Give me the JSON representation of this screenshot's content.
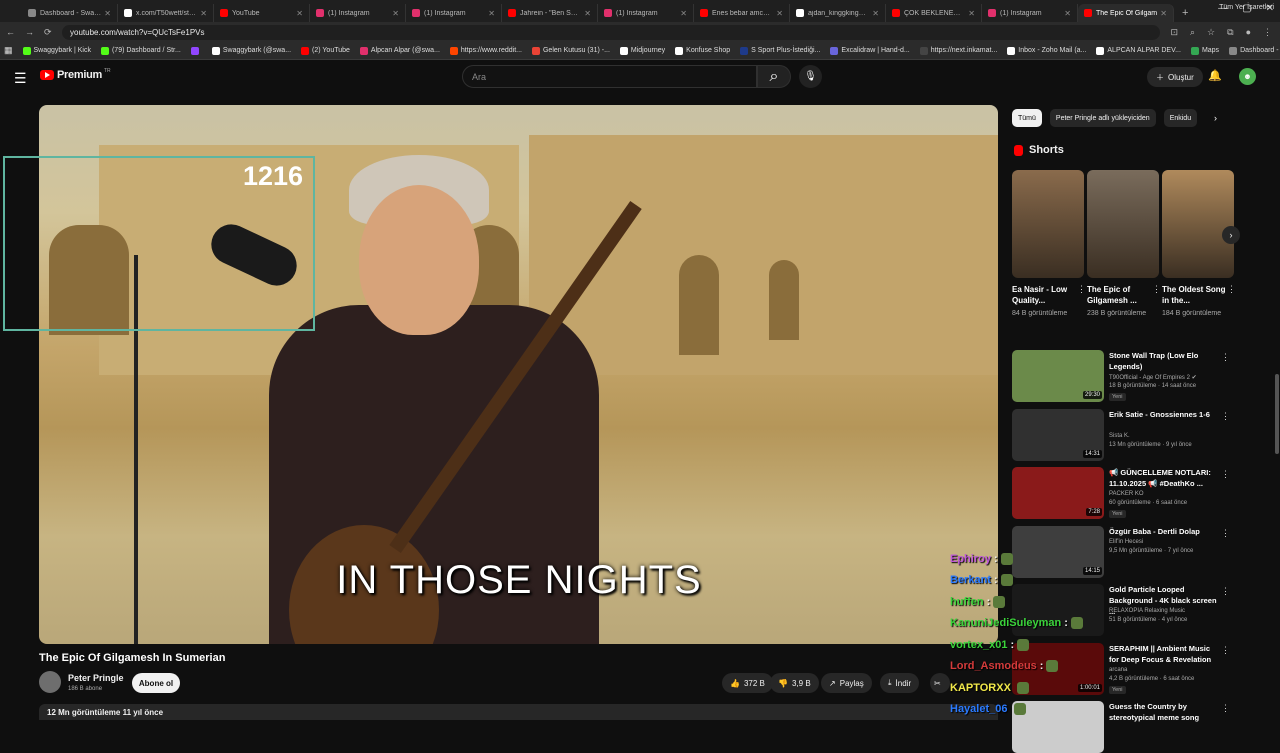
{
  "browser": {
    "tabs": [
      {
        "title": "Dashboard - Swaggyb",
        "color": "#888888"
      },
      {
        "title": "x.com/T50wett/status",
        "color": "#ffffff"
      },
      {
        "title": "YouTube",
        "color": "#ff0000"
      },
      {
        "title": "(1) Instagram",
        "color": "#e1306c"
      },
      {
        "title": "(1) Instagram",
        "color": "#e1306c"
      },
      {
        "title": "Jahrein - \"Ben Seni D",
        "color": "#ff0000"
      },
      {
        "title": "(1) Instagram",
        "color": "#e1306c"
      },
      {
        "title": "Enes bebar amcasına",
        "color": "#ff0000"
      },
      {
        "title": "ajdan_kinggkingg (@",
        "color": "#ffffff"
      },
      {
        "title": "ÇOK BEKLENEN PSİKO",
        "color": "#ff0000"
      },
      {
        "title": "(1) Instagram",
        "color": "#e1306c"
      },
      {
        "title": "The Epic Of Gilgam",
        "color": "#ff0000"
      }
    ],
    "url": "youtube.com/watch?v=QUcTsFe1PVs",
    "bookmarks": [
      {
        "label": "Swaggybark | Kick",
        "color": "#53fc18"
      },
      {
        "label": "(79) Dashboard / Str...",
        "color": "#53fc18"
      },
      {
        "label": "",
        "color": "#9146ff"
      },
      {
        "label": "Swaggybark (@swa...",
        "color": "#ffffff"
      },
      {
        "label": "(2) YouTube",
        "color": "#ff0000"
      },
      {
        "label": "Alpcan Alpar (@swa...",
        "color": "#e1306c"
      },
      {
        "label": "https://www.reddit...",
        "color": "#ff4500"
      },
      {
        "label": "Gelen Kutusu (31) -...",
        "color": "#ea4335"
      },
      {
        "label": "Midjourney",
        "color": "#ffffff"
      },
      {
        "label": "Konfuse Shop",
        "color": "#ffffff"
      },
      {
        "label": "S Sport Plus-İstediği...",
        "color": "#1e3a8a"
      },
      {
        "label": "Excalidraw | Hand-d...",
        "color": "#6965db"
      },
      {
        "label": "https://next.inkamat...",
        "color": "#444444"
      },
      {
        "label": "Inbox - Zoho Mail (a...",
        "color": "#ffffff"
      },
      {
        "label": "ALPCAN ALPAR DEV...",
        "color": "#ffffff"
      },
      {
        "label": "Maps",
        "color": "#34a853"
      },
      {
        "label": "Dashboard - Swagg...",
        "color": "#888888"
      }
    ],
    "all_bookmarks": "Tüm Yer İşaretleri"
  },
  "header": {
    "logo": "Premium",
    "logo_sup": "TR",
    "search_placeholder": "Ara",
    "create_label": "Oluştur"
  },
  "video": {
    "counter": "1216",
    "subtitle": "IN THOSE NIGHTS",
    "title": "The Epic Of Gilgamesh In Sumerian",
    "channel": "Peter Pringle",
    "subs": "186 B abone",
    "subscribe": "Abone ol",
    "likes": "372 B",
    "dislikes": "3,9 B",
    "share": "Paylaş",
    "download": "İndir",
    "meta": "12 Mn görüntüleme  11 yıl önce"
  },
  "sidebar": {
    "chips": [
      "Tümü",
      "Peter Pringle adlı yükleyiciden",
      "Enkidu"
    ],
    "shorts_title": "Shorts",
    "shorts": [
      {
        "title": "Ea Nasir - Low Quality...",
        "views": "84 B görüntüleme",
        "color": "#8a6b4c"
      },
      {
        "title": "The Epic of Gilgamesh ...",
        "views": "238 B görüntüleme",
        "color": "#7a6c5c"
      },
      {
        "title": "The Oldest Song in the...",
        "views": "184 B görüntüleme",
        "color": "#b08a5c"
      }
    ],
    "recs": [
      {
        "title": "Stone Wall Trap (Low Elo Legends)",
        "channel": "T90Official - Age Of Empires 2 ✔",
        "views": "18 B görüntüleme · 14 saat önce",
        "badge": "Yeni",
        "dur": "29:30",
        "color": "#6b8a4a"
      },
      {
        "title": "Erik Satie - Gnossiennes 1-6",
        "channel": "Sista K.",
        "views": "13 Mn görüntüleme · 9 yıl önce",
        "badge": "",
        "dur": "14:31",
        "color": "#303030"
      },
      {
        "title": "📢 GÜNCELLEME NOTLARI: 11.10.2025 📢 #DeathKo ...",
        "channel": "PACKER KO",
        "views": "60 görüntüleme · 6 saat önce",
        "badge": "Yeni",
        "dur": "7:28",
        "color": "#8a1a1a"
      },
      {
        "title": "Özgür Baba - Dertli Dolap",
        "channel": "Elif'in Hecesi",
        "views": "9,5 Mn görüntüleme · 7 yıl önce",
        "badge": "",
        "dur": "14:15",
        "color": "#3e3e3e"
      },
      {
        "title": "Gold Particle Looped Background - 4K black screen ...",
        "channel": "RELAXOPIA Relaxing Music",
        "views": "51 B görüntüleme · 4 yıl önce",
        "badge": "",
        "dur": "",
        "color": "#1a1a1a"
      },
      {
        "title": "SERAPHIM || Ambient Music for Deep Focus & Revelation",
        "channel": "arcana",
        "views": "4,2 B görüntüleme · 6 saat önce",
        "badge": "Yeni",
        "dur": "1:00:01",
        "color": "#5a0a0a"
      },
      {
        "title": "Guess the Country by stereotypical meme song",
        "channel": "",
        "views": "",
        "badge": "",
        "dur": "",
        "color": "#cccccc"
      }
    ]
  },
  "chat": [
    {
      "name": "Ephiroy",
      "sep": ":",
      "color": "#c05ad8"
    },
    {
      "name": "Berkant",
      "sep": ":",
      "color": "#2b7bff"
    },
    {
      "name": "huffen",
      "sep": ":",
      "color": "#3bd43b"
    },
    {
      "name": "KanuniJediSuleyman",
      "sep": ":",
      "color": "#3bd43b"
    },
    {
      "name": "vortex_x01",
      "sep": ":",
      "color": "#3bd43b"
    },
    {
      "name": "Lord_Asmodeus",
      "sep": ":",
      "color": "#d43b3b"
    },
    {
      "name": "KAPTORXX",
      "sep": "",
      "color": "#f1e84a"
    },
    {
      "name": "Hayalet_06",
      "sep": "",
      "color": "#2b7bff"
    }
  ]
}
